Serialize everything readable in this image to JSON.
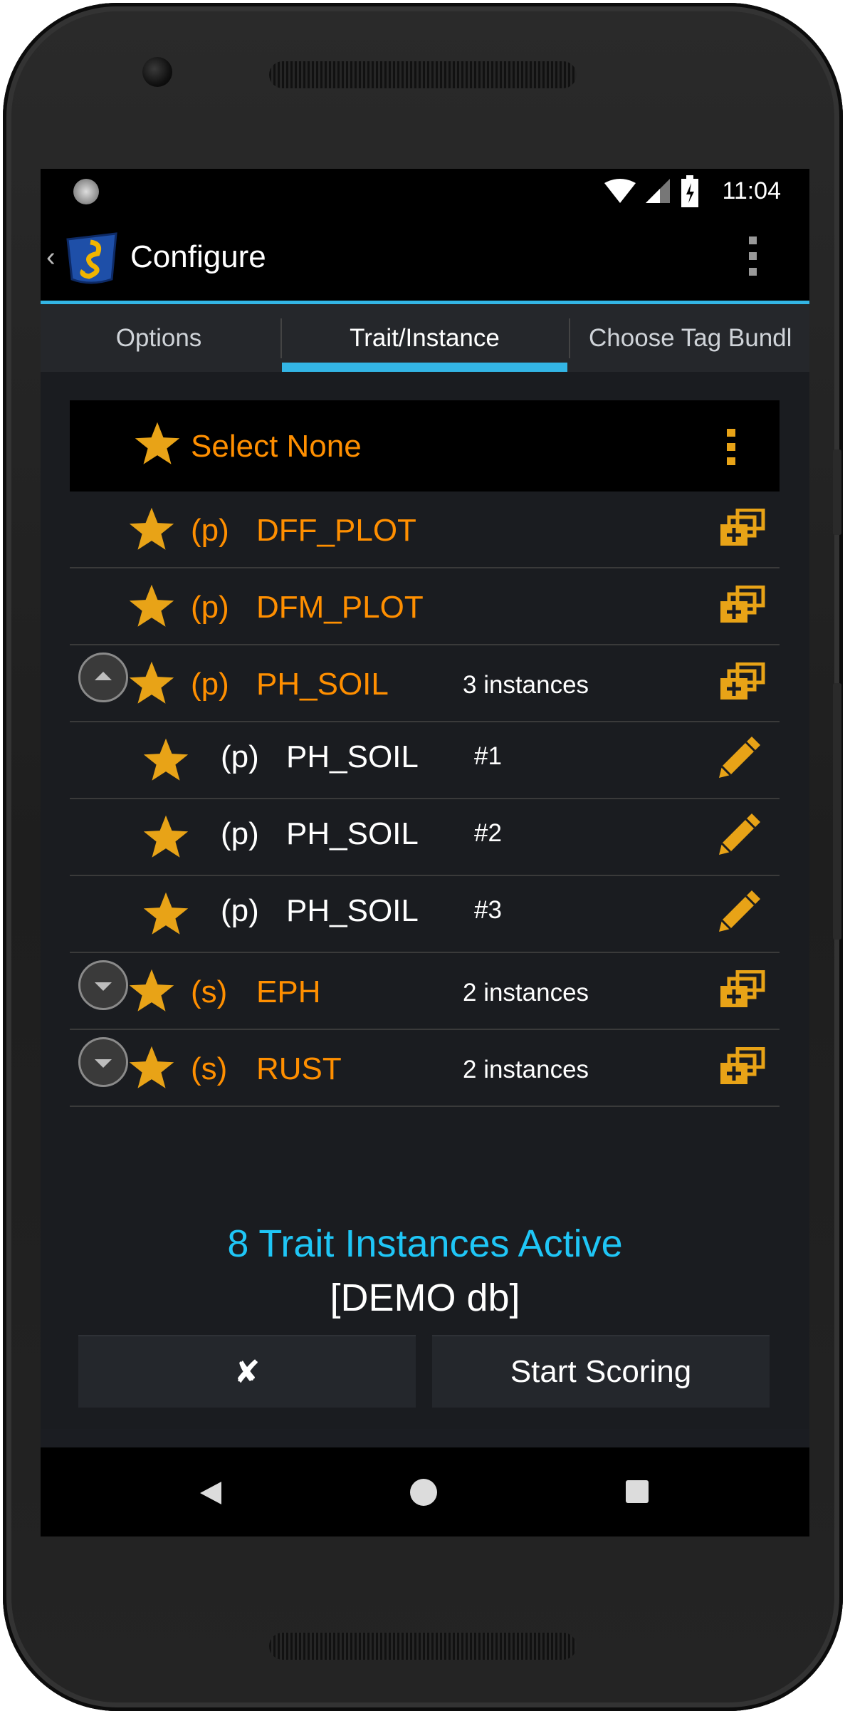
{
  "status_bar": {
    "time": "11:04"
  },
  "action_bar": {
    "title": "Configure"
  },
  "tabs": [
    {
      "label": "Options"
    },
    {
      "label": "Trait/Instance"
    },
    {
      "label": "Choose Tag Bundl"
    }
  ],
  "list": {
    "header_label": "Select None",
    "rows": [
      {
        "prefix": "(p)",
        "name": "DFF_PLOT",
        "count": ""
      },
      {
        "prefix": "(p)",
        "name": "DFM_PLOT",
        "count": ""
      },
      {
        "prefix": "(p)",
        "name": "PH_SOIL",
        "count": "3 instances"
      },
      {
        "prefix": "(p)",
        "name": "PH_SOIL",
        "count": "#1"
      },
      {
        "prefix": "(p)",
        "name": "PH_SOIL",
        "count": "#2"
      },
      {
        "prefix": "(p)",
        "name": "PH_SOIL",
        "count": "#3"
      },
      {
        "prefix": "(s)",
        "name": "EPH",
        "count": "2 instances"
      },
      {
        "prefix": "(s)",
        "name": "RUST",
        "count": "2 instances"
      }
    ]
  },
  "summary": {
    "active": "8 Trait Instances Active",
    "db": "[DEMO db]"
  },
  "buttons": {
    "cancel": "✘",
    "start": "Start Scoring"
  },
  "colors": {
    "accent": "#33b5e5",
    "trait": "#ff8f00",
    "star": "#e8a317",
    "active_text": "#1fc6f6"
  }
}
